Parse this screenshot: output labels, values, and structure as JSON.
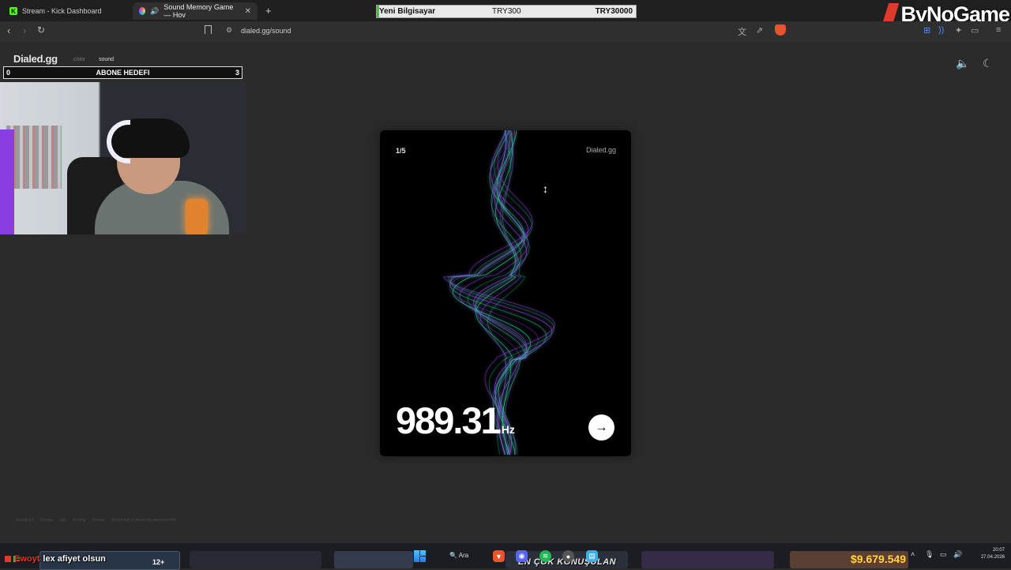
{
  "browser": {
    "tabs": [
      {
        "title": "Stream - Kick Dashboard",
        "favicon": "kick-logo"
      },
      {
        "title": "Sound Memory Game — Hov",
        "favicon": "dialed-logo",
        "active": true
      }
    ],
    "new_tab": "+",
    "url": "dialed.gg/sound"
  },
  "donation_bar": {
    "title": "Yeni Bilgisayar",
    "current": "TRY300",
    "goal": "TRY30000",
    "progress_fraction": 0.01
  },
  "watermark": {
    "text": "ByNoGame"
  },
  "site": {
    "logo": "Dialed.gg",
    "nav": {
      "color": "color",
      "sound": "sound"
    },
    "footer_links": [
      "Sound 1.0",
      "Privacy",
      "Lab",
      "Scoring",
      "Socials",
      "Do not sell or share my personal info"
    ]
  },
  "sub_goal": {
    "start": "0",
    "title": "ABONE HEDEFI",
    "end": "3"
  },
  "game": {
    "step": "1/5",
    "brand": "Dialed.gg",
    "frequency": "989.31",
    "unit": "Hz"
  },
  "taskbar": {
    "chat_user": "Ewoyt",
    "chat_message": "lex afiyet olsun",
    "badge": "12+",
    "search_label": "Ara",
    "overlay_text": "EN ÇOK KONUŞULAN",
    "money_text": "$9.679.549",
    "clock_time": "20:07",
    "clock_date": "27.04.2026"
  },
  "colors": {
    "accent_green": "#2ecc40",
    "kick_green": "#53fc18",
    "brand_red": "#e03a2c",
    "wave_teal": "#2fe3b0",
    "wave_purple": "#9b4dff"
  }
}
